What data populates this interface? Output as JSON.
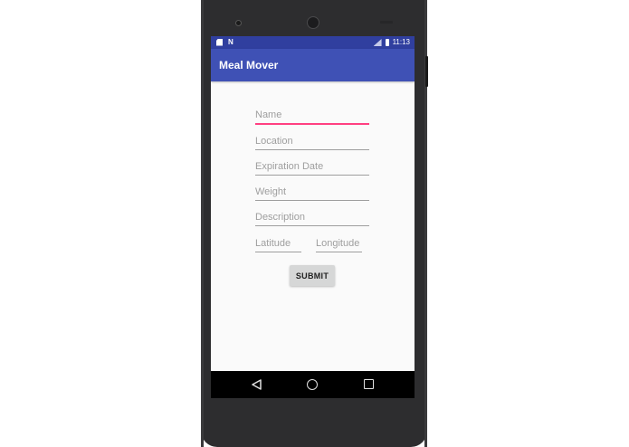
{
  "status_bar": {
    "time": "11:13",
    "left_icons": [
      "sim-card-icon",
      "n-notification-icon"
    ],
    "right_icons": [
      "signal-icon",
      "battery-icon"
    ]
  },
  "app_bar": {
    "title": "Meal Mover"
  },
  "form": {
    "name_placeholder": "Name",
    "location_placeholder": "Location",
    "expiration_placeholder": "Expiration Date",
    "weight_placeholder": "Weight",
    "description_placeholder": "Description",
    "latitude_placeholder": "Latitude",
    "longitude_placeholder": "Longitude",
    "submit_label": "SUBMIT"
  },
  "nav_bar": {
    "icons": [
      "back-icon",
      "home-icon",
      "recents-icon"
    ]
  },
  "colors": {
    "primary": "#3f51b5",
    "primary_dark": "#303f9f",
    "accent": "#ff4081",
    "background": "#fafafa"
  }
}
